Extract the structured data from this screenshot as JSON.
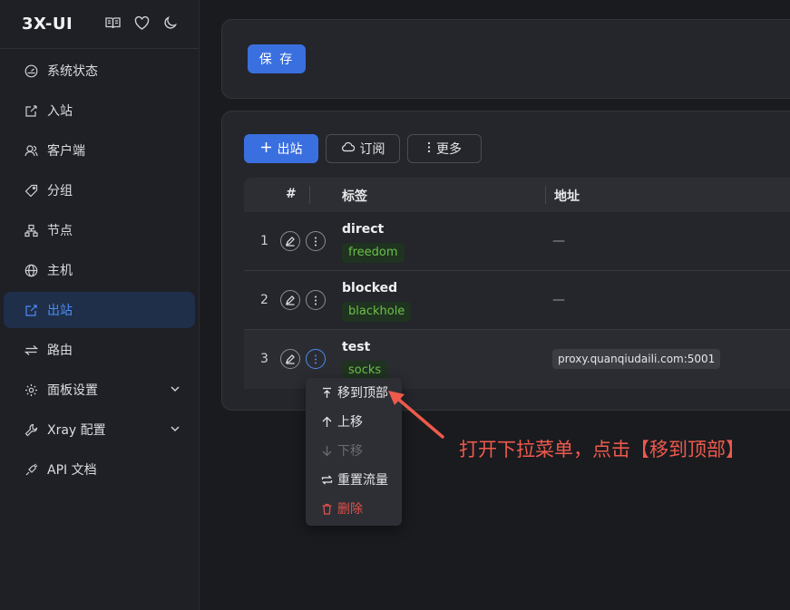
{
  "app": {
    "title": "3X-UI"
  },
  "sidebar": {
    "items": [
      {
        "label": "系统状态",
        "icon": "dashboard-icon"
      },
      {
        "label": "入站",
        "icon": "inbound-icon"
      },
      {
        "label": "客户端",
        "icon": "users-icon"
      },
      {
        "label": "分组",
        "icon": "tag-icon"
      },
      {
        "label": "节点",
        "icon": "cluster-icon"
      },
      {
        "label": "主机",
        "icon": "globe-icon"
      },
      {
        "label": "出站",
        "icon": "outbound-icon",
        "active": true
      },
      {
        "label": "路由",
        "icon": "swap-icon"
      },
      {
        "label": "面板设置",
        "icon": "gear-icon",
        "expandable": true
      },
      {
        "label": "Xray 配置",
        "icon": "wrench-icon",
        "expandable": true
      },
      {
        "label": "API 文档",
        "icon": "api-icon"
      }
    ]
  },
  "toolbar": {
    "save_label": "保 存",
    "add_outbound_label": "出站",
    "subscribe_label": "订阅",
    "more_label": "更多"
  },
  "table": {
    "columns": [
      "#",
      "标签",
      "地址"
    ],
    "rows": [
      {
        "index": "1",
        "tag": "direct",
        "protocol": "freedom",
        "address": "—"
      },
      {
        "index": "2",
        "tag": "blocked",
        "protocol": "blackhole",
        "address": "—"
      },
      {
        "index": "3",
        "tag": "test",
        "protocol": "socks",
        "address": "proxy.quanqiudaili.com:5001"
      }
    ]
  },
  "dropdown": {
    "items": [
      {
        "label": "移到顶部",
        "icon": "move-top-icon"
      },
      {
        "label": "上移",
        "icon": "arrow-up-icon"
      },
      {
        "label": "下移",
        "icon": "arrow-down-icon",
        "disabled": true
      },
      {
        "label": "重置流量",
        "icon": "reset-icon"
      },
      {
        "label": "删除",
        "icon": "trash-icon",
        "danger": true
      }
    ]
  },
  "annotation": {
    "text": "打开下拉菜单，点击【移到顶部】"
  },
  "colors": {
    "accent": "#3a6fe0",
    "annotation": "#ee5a4c",
    "tag_green": "#6cc04a",
    "danger": "#e0504a"
  }
}
